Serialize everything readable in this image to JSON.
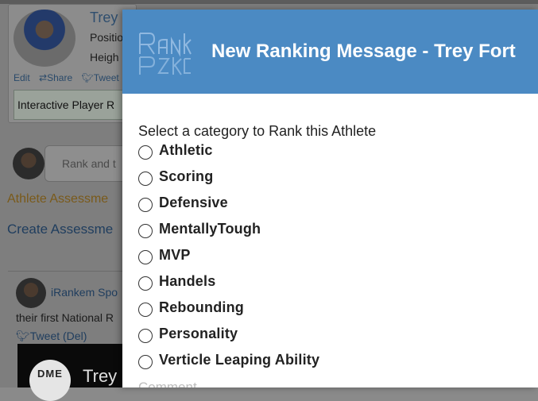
{
  "background": {
    "profile": {
      "name": "Trey",
      "position_label": "Positio",
      "height_label": "Heigh",
      "edit": "Edit",
      "share": "Share",
      "tweet": "Tweet",
      "interactive_label": "Interactive Player R"
    },
    "rank_input_placeholder": "Rank and t",
    "athlete_assessment_link": "Athlete Assessme",
    "create_assessment_link": "Create Assessme",
    "feed": {
      "author": "iRankem Spo",
      "text": "their first National R",
      "tweet_del": "Tweet (Del)",
      "media_logo": "DME",
      "media_title": "Trey"
    }
  },
  "modal": {
    "title": "New Ranking Message - Trey Fort",
    "prompt": "Select a category to Rank this Athlete",
    "options": [
      "Athletic",
      "Scoring",
      "Defensive",
      "MentallyTough",
      "MVP",
      "Handels",
      "Rebounding",
      "Personality",
      "Verticle Leaping Ability"
    ],
    "comment_placeholder": "Comment"
  },
  "colors": {
    "header_blue": "#4b8ac3",
    "overlay": "#7e7e7e"
  }
}
